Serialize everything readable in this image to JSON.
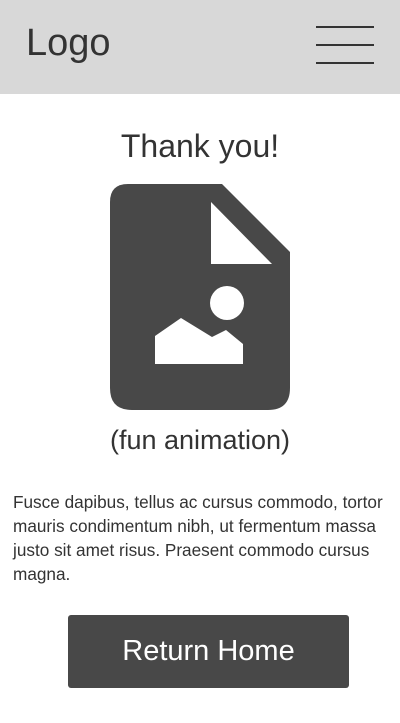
{
  "header": {
    "logo_text": "Logo",
    "menu_icon": "hamburger-menu-icon"
  },
  "main": {
    "title": "Thank you!",
    "illustration_icon": "image-file-icon",
    "caption": "(fun animation)",
    "body": "Fusce dapibus, tellus ac cursus commodo, tortor mauris condimentum nibh, ut fermentum massa justo sit amet risus. Praesent commodo cursus magna.",
    "button_label": "Return Home"
  },
  "colors": {
    "header_bg": "#d8d8d8",
    "text": "#333333",
    "icon": "#484848",
    "button_bg": "#484848",
    "button_text": "#ffffff"
  }
}
